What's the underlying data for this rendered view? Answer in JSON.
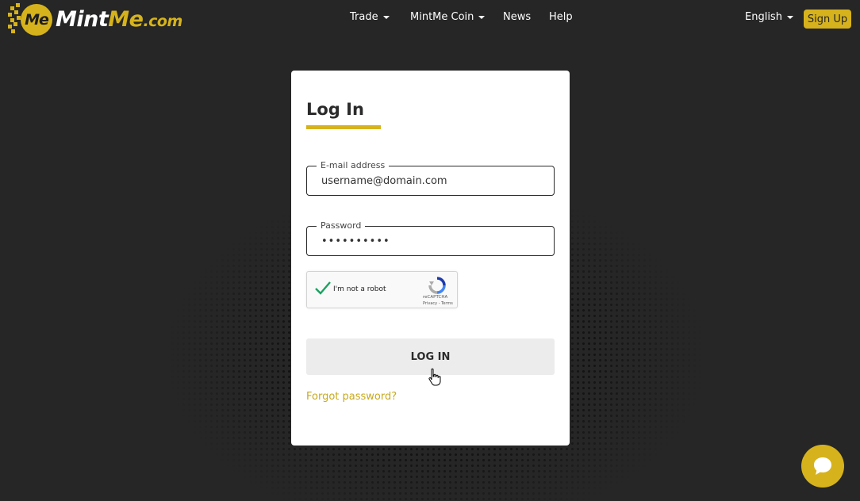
{
  "brand": {
    "logo_mark_text": "Me",
    "name_part1": "Mint",
    "name_part2": "Me",
    "name_part3": ".com",
    "accent_color": "#d6b31c"
  },
  "nav": {
    "items": [
      {
        "label": "Trade",
        "has_dropdown": true
      },
      {
        "label": "MintMe Coin",
        "has_dropdown": true
      },
      {
        "label": "News",
        "has_dropdown": false
      },
      {
        "label": "Help",
        "has_dropdown": false
      }
    ],
    "language": "English",
    "signup_label": "Sign Up"
  },
  "login": {
    "title": "Log In",
    "email_label": "E-mail address",
    "email_value": "username@domain.com",
    "password_label": "Password",
    "password_value": "••••••••••",
    "recaptcha": {
      "label": "I'm not a robot",
      "checked": true,
      "brand": "reCAPTCHA",
      "terms": "Privacy - Terms"
    },
    "submit_label": "LOG IN",
    "forgot_label": "Forgot password?"
  },
  "icons": {
    "chat": "chat-bubble-icon",
    "caret": "chevron-down-icon",
    "cursor": "hand-pointer-icon"
  }
}
